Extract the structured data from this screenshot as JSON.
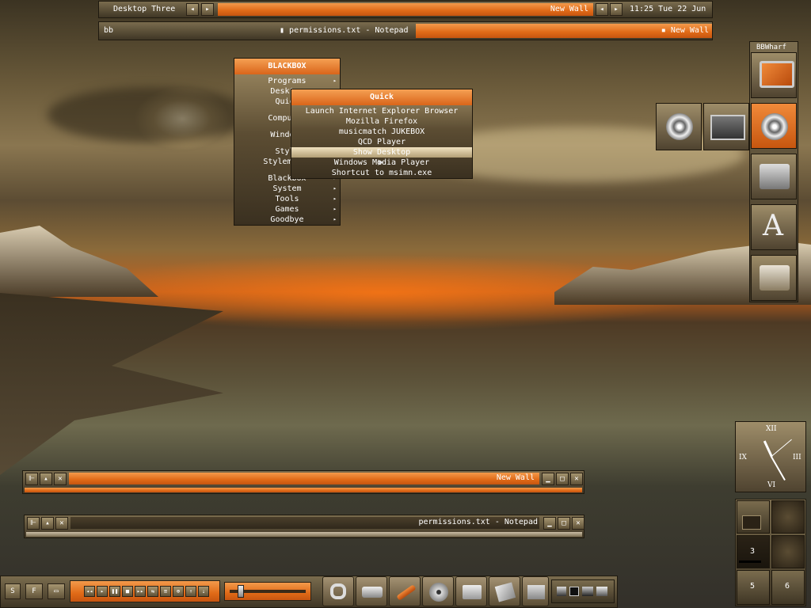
{
  "toolbar": {
    "workspace": "Desktop Three",
    "prev": "◂",
    "next": "▸",
    "window_title": "New Wall",
    "clock": "11:25 Tue 22 Jun"
  },
  "iconbar": {
    "label": "bb",
    "task1": "permissions.txt - Notepad",
    "task2": "New Wall"
  },
  "menu": {
    "title": "BLACKBOX",
    "items": [
      "Programs",
      "Desktop",
      "Quick",
      "",
      "Computer",
      "",
      "Windows",
      "",
      "Style",
      "Stylemaker",
      "",
      "Blackbox",
      "System",
      "Tools",
      "Games",
      "Goodbye"
    ],
    "submenu_title": "Quick",
    "sub_items": [
      "Launch Internet Explorer Browser",
      "Mozilla Firefox",
      "musicmatch JUKEBOX",
      "QCD Player",
      "Show Desktop",
      "Windows Media Player",
      "Shortcut to msimn.exe"
    ],
    "sub_selected": "Show Desktop"
  },
  "wharf": {
    "title": "BBWharf",
    "icons": [
      "monitor-icon",
      "media-player-icon",
      "control-panel-icon",
      "fonts-icon",
      "trumpet-folder-icon"
    ],
    "extra_icons": [
      "media-player-icon",
      "display-icon"
    ]
  },
  "windows": {
    "win1_title": "New Wall",
    "win2_title": "permissions.txt - Notepad"
  },
  "clock": {
    "xii": "XII",
    "iii": "III",
    "vi": "VI",
    "ix": "IX"
  },
  "pager": {
    "desks": [
      "",
      "",
      "3",
      "",
      "5",
      "6"
    ]
  },
  "bottom": {
    "btn_s": "S",
    "btn_f": "F",
    "player_controls": [
      "◂◂",
      "▸",
      "❚❚",
      "■",
      "▸▸",
      "⇆",
      "≡",
      "⊕",
      "⇡",
      "⇣"
    ],
    "dock_icons": [
      "links-icon",
      "drive-icon",
      "tools-icon",
      "reel-icon",
      "folder-icon",
      "disk-icon",
      "documents-icon"
    ],
    "tray_icons": [
      "tray-icon-1",
      "tray-icon-2",
      "tray-icon-3",
      "tray-icon-4"
    ]
  },
  "colors": {
    "accent": "#e06a17",
    "panel": "#6b5c40"
  }
}
